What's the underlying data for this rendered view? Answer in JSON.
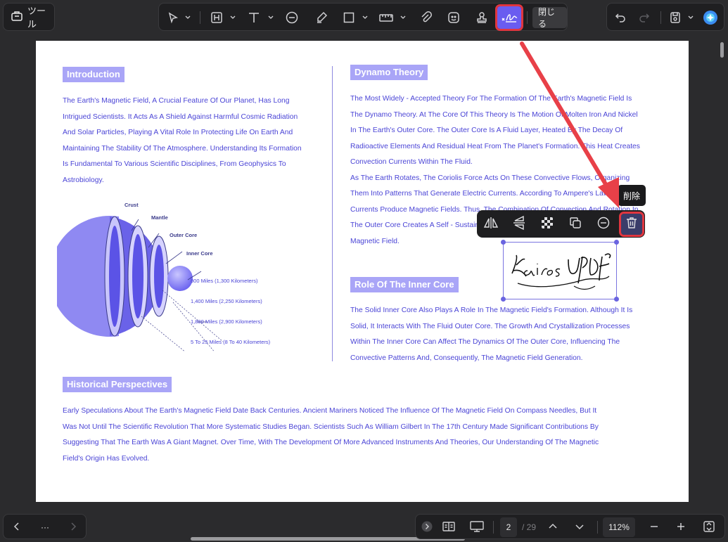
{
  "toolbar": {
    "tools_label": "ツール",
    "close_label": "閉じる"
  },
  "document": {
    "introduction": {
      "heading": "Introduction",
      "lines": [
        "The Earth's Magnetic Field, A Crucial Feature Of Our Planet, Has Long",
        "Intrigued Scientists. It Acts As A Shield Against Harmful Cosmic Radiation",
        "And Solar Particles, Playing A Vital Role In Protecting Life On Earth And",
        "Maintaining The Stability Of The Atmosphere. Understanding Its Formation",
        "Is Fundamental To Various Scientific Disciplines, From Geophysics To",
        "Astrobiology."
      ]
    },
    "diagram": {
      "layers": [
        "Crust",
        "Mantle",
        "Outer Core",
        "Inner Core"
      ],
      "measurements": [
        "800 Miles (1,300 Kilometers)",
        "1,400 Miles (2,250 Kilometers)",
        "1,800 Miles (2,900 Kilometers)",
        "5 To 25 Miles (8 To 40 Kilometers)"
      ]
    },
    "dynamo": {
      "heading": "Dynamo Theory",
      "lines": [
        "The Most Widely - Accepted Theory For The Formation Of The Earth's Magnetic Field Is",
        "The Dynamo Theory. At The Core Of This Theory Is The Motion Of Molten Iron And Nickel",
        "In The Earth's Outer Core. The Outer Core Is A Fluid Layer, Heated By The Decay Of",
        "Radioactive Elements And Residual Heat From The Planet's Formation. This Heat Creates",
        "Convection Currents Within The Fluid.",
        "As The Earth Rotates, The Coriolis Force Acts On These Convective Flows, Organizing",
        "Them Into Patterns That Generate Electric Currents. According To Ampere's Law, These",
        "Currents Produce Magnetic Fields. Thus, The Combination Of Convection And Rotation In",
        "The Outer Core Creates A Self - Sustaining",
        "Magnetic Field."
      ]
    },
    "inner_core": {
      "heading": "Role Of The Inner Core",
      "lines": [
        "The Solid Inner Core Also Plays A Role In The Magnetic Field's Formation. Although It Is",
        "Solid, It Interacts With The Fluid Outer Core. The Growth And Crystallization Processes",
        "Within The Inner Core Can Affect The Dynamics Of The Outer Core, Influencing The",
        "Convective Patterns And, Consequently, The Magnetic Field Generation."
      ]
    },
    "historical": {
      "heading": "Historical Perspectives",
      "lines": [
        "Early Speculations About The Earth's Magnetic Field Date Back Centuries. Ancient Mariners Noticed The Influence Of The Magnetic Field On Compass Needles, But It",
        "Was Not Until The Scientific Revolution That More Systematic Studies Began. Scientists Such As William Gilbert In The 17th Century Made Significant Contributions By",
        "Suggesting That The Earth Was A Giant Magnet. Over Time, With The Development Of More Advanced Instruments And Theories, Our Understanding Of The Magnetic",
        "Field's Origin Has Evolved."
      ]
    },
    "signature": "Kairos UPDF"
  },
  "context_menu": {
    "tooltip": "削除"
  },
  "bottom_bar": {
    "more_label": "···",
    "current_page": "2",
    "total_pages": "/ 29",
    "zoom": "112%"
  }
}
